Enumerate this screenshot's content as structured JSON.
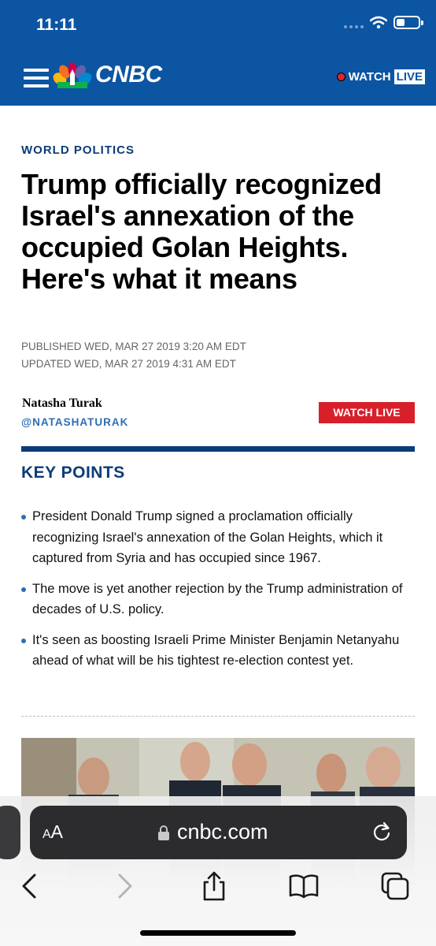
{
  "status_bar": {
    "time": "11:11"
  },
  "header": {
    "brand": "CNBC",
    "watch_label": "WATCH",
    "live_label": "LIVE"
  },
  "article": {
    "category": "WORLD POLITICS",
    "headline": "Trump officially recognized Israel's annexation of the occupied Golan Heights. Here's what it means",
    "published": "PUBLISHED WED, MAR 27 2019 3:20 AM EDT",
    "updated": "UPDATED WED, MAR 27 2019 4:31 AM EDT",
    "author": "Natasha Turak",
    "author_handle": "@NATASHATURAK",
    "watch_live_button": "WATCH LIVE"
  },
  "key_points": {
    "title": "KEY POINTS",
    "items": [
      "President Donald Trump signed a proclamation officially recognizing Israel's annexation of the Golan Heights, which it captured from Syria and has occupied since 1967.",
      "The move is yet another rejection by the Trump administration of decades of U.S. policy.",
      "It's seen as boosting Israeli Prime Minister Benjamin Netanyahu ahead of what will be his tightest re-election contest yet."
    ]
  },
  "browser": {
    "text_size_label_small": "A",
    "text_size_label_large": "A",
    "url": "cnbc.com"
  },
  "colors": {
    "header_blue": "#0c55a2",
    "navy": "#0c3c78",
    "live_red": "#d8202a",
    "link_blue": "#2f6db5"
  },
  "icons": [
    "menu-icon",
    "peacock-logo-icon",
    "live-dot-icon",
    "lock-icon",
    "reload-icon",
    "back-icon",
    "forward-icon",
    "share-icon",
    "bookmarks-icon",
    "tabs-icon",
    "wifi-icon",
    "signal-icon",
    "battery-icon"
  ]
}
